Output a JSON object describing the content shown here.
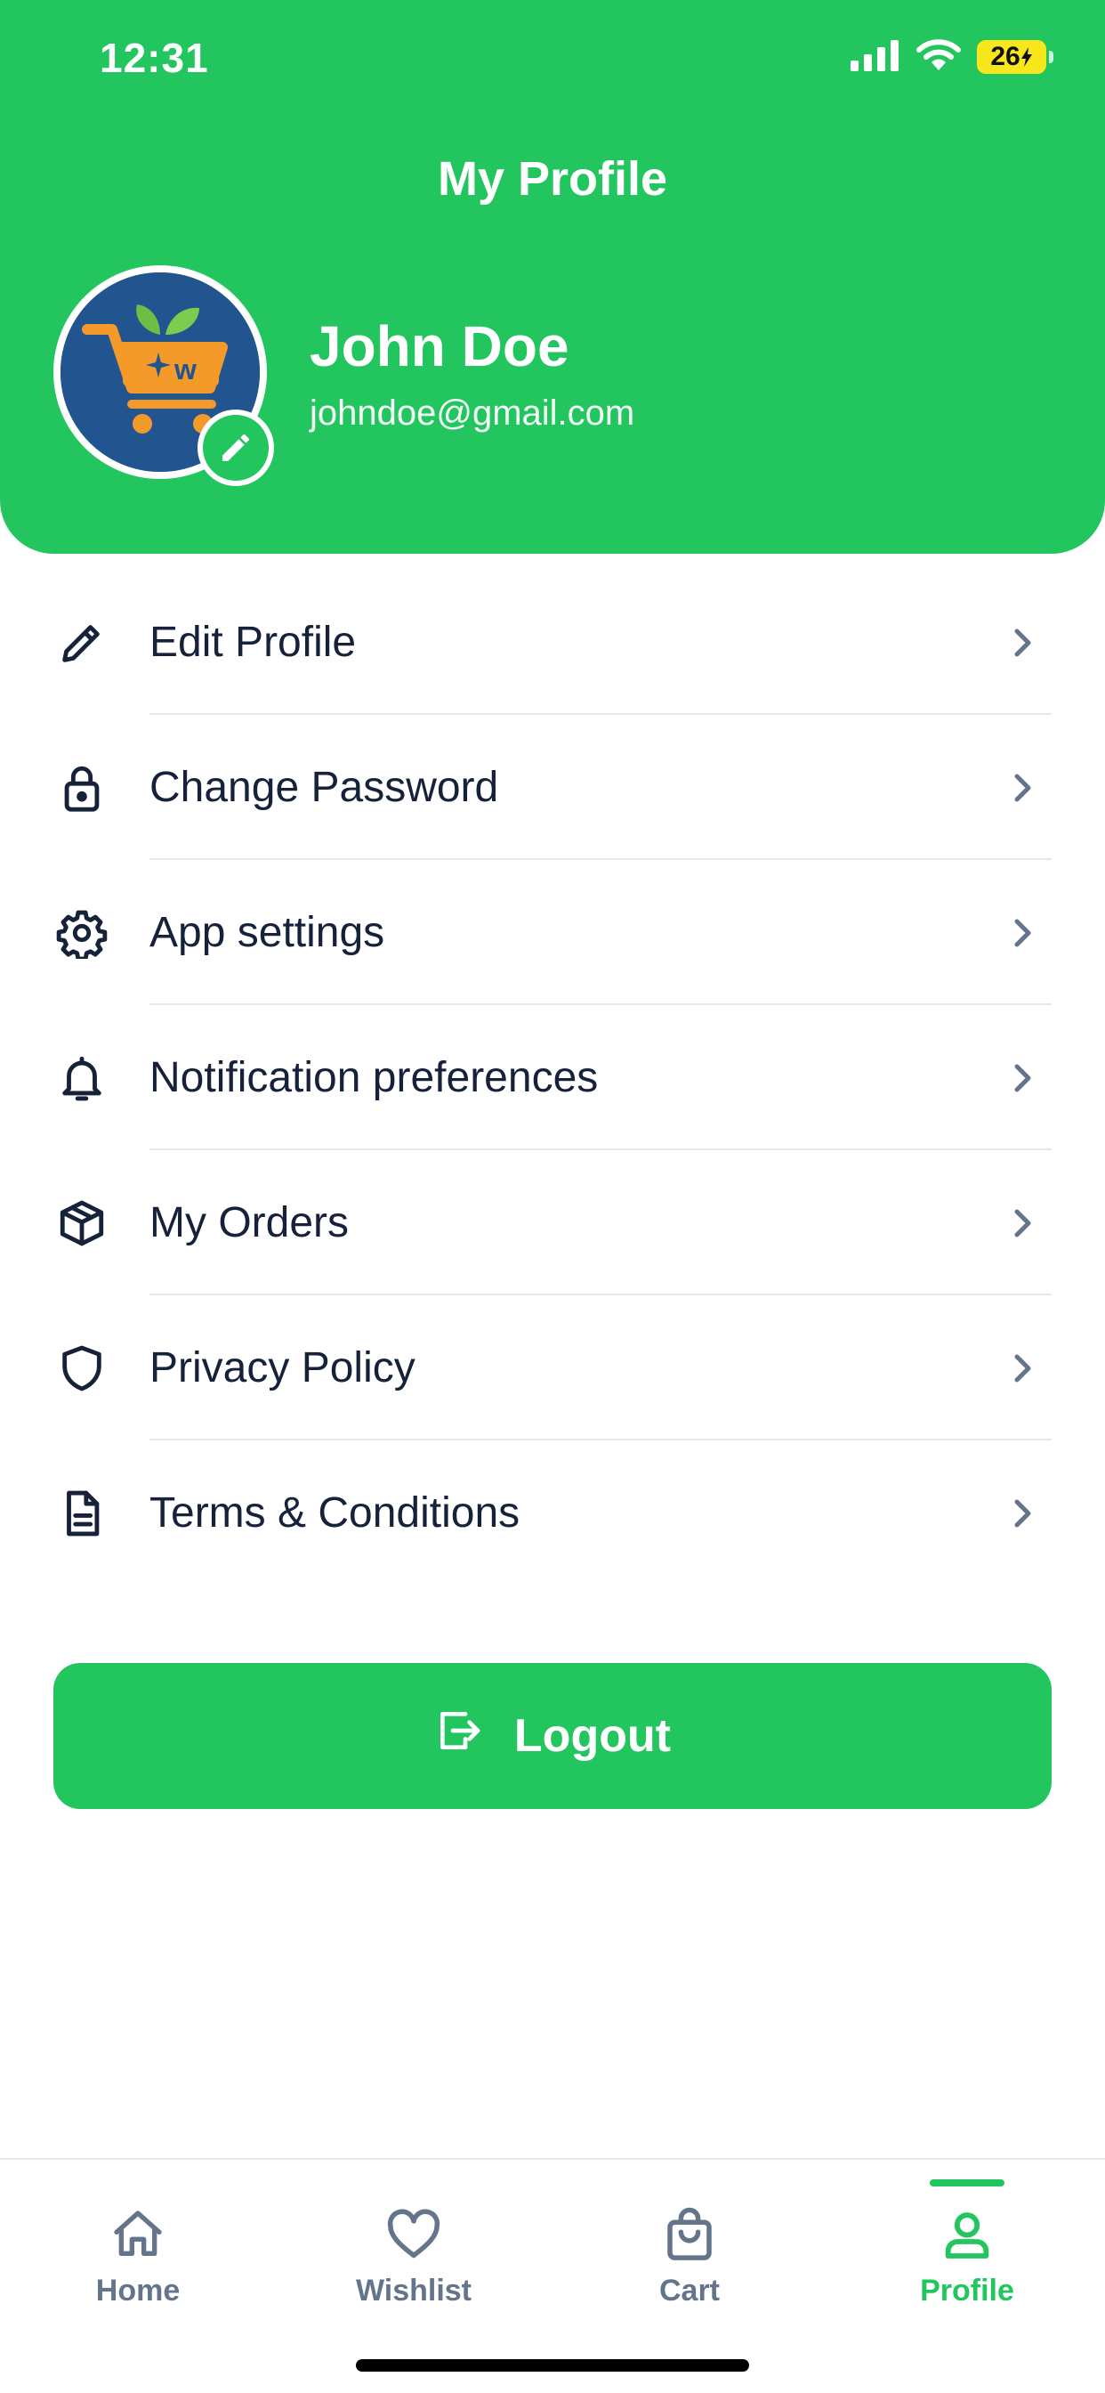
{
  "status_bar": {
    "time": "12:31",
    "battery": "26"
  },
  "header": {
    "title": "My Profile",
    "user_name": "John Doe",
    "user_email": "johndoe@gmail.com"
  },
  "menu": {
    "items": [
      {
        "label": "Edit Profile",
        "icon": "pencil-icon"
      },
      {
        "label": "Change Password",
        "icon": "lock-icon"
      },
      {
        "label": "App settings",
        "icon": "gear-icon"
      },
      {
        "label": "Notification preferences",
        "icon": "bell-icon"
      },
      {
        "label": "My Orders",
        "icon": "box-icon"
      },
      {
        "label": "Privacy Policy",
        "icon": "shield-icon"
      },
      {
        "label": "Terms & Conditions",
        "icon": "document-icon"
      }
    ]
  },
  "logout": {
    "label": "Logout",
    "icon": "logout-icon"
  },
  "tabbar": {
    "tabs": [
      {
        "label": "Home",
        "icon": "home-icon",
        "active": false
      },
      {
        "label": "Wishlist",
        "icon": "heart-icon",
        "active": false
      },
      {
        "label": "Cart",
        "icon": "shopping-bag-icon",
        "active": false
      },
      {
        "label": "Profile",
        "icon": "user-icon",
        "active": true
      }
    ]
  },
  "colors": {
    "primary": "#22C55E",
    "text": "#16213A",
    "muted": "#64748B"
  }
}
